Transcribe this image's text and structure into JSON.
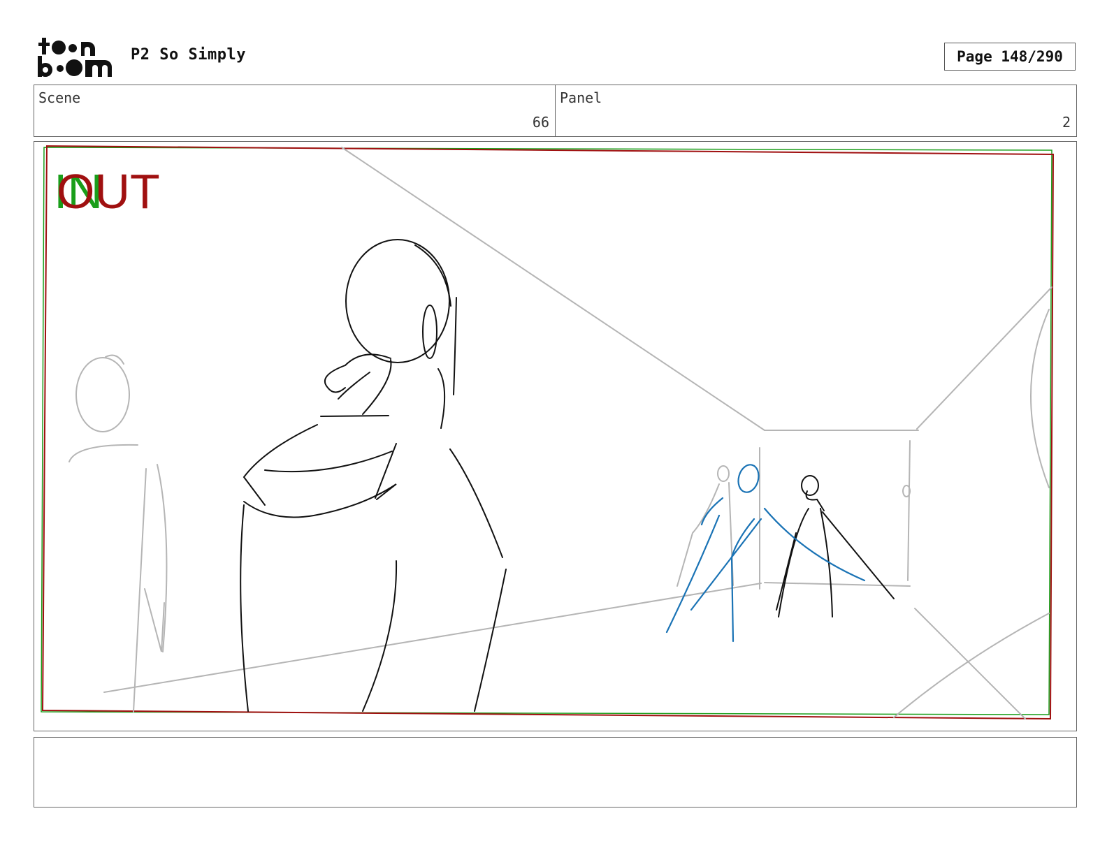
{
  "header": {
    "project_title": "P2 So Simply",
    "page_indicator": "Page 148/290"
  },
  "scene": {
    "label": "Scene",
    "value": "66"
  },
  "panel": {
    "label": "Panel",
    "value": "2"
  },
  "frame_marks": {
    "in_label": "IN",
    "out_label": "OUT"
  },
  "colors": {
    "in_green": "#1a9e1a",
    "out_red": "#a01010",
    "sketch_black": "#111111",
    "sketch_gray": "#b5b5b5",
    "sketch_blue": "#1a73b5"
  },
  "notes": {
    "text": ""
  }
}
